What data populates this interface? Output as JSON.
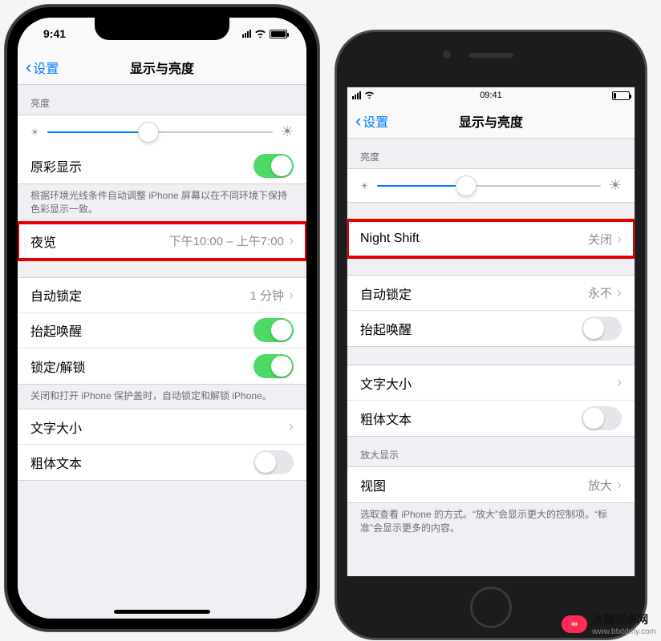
{
  "status": {
    "time": "9:41",
    "time8": "09:41"
  },
  "nav": {
    "back": "设置",
    "title": "显示与亮度"
  },
  "left": {
    "brightness_header": "亮度",
    "slider_percent": 45,
    "truetone": {
      "label": "原彩显示",
      "on": true
    },
    "truetone_note": "根据环境光线条件自动调整 iPhone 屏幕以在不同环境下保持色彩显示一致。",
    "nightshift": {
      "label": "夜览",
      "value": "下午10:00 – 上午7:00"
    },
    "autolock": {
      "label": "自动锁定",
      "value": "1 分钟"
    },
    "raise": {
      "label": "抬起唤醒",
      "on": true
    },
    "lockunlock": {
      "label": "锁定/解锁",
      "on": true
    },
    "lock_note": "关闭和打开 iPhone 保护盖时，自动锁定和解锁 iPhone。",
    "textsize": {
      "label": "文字大小"
    },
    "bold": {
      "label": "粗体文本",
      "on": false
    }
  },
  "right": {
    "brightness_header": "亮度",
    "slider_percent": 40,
    "nightshift": {
      "label": "Night Shift",
      "value": "关闭"
    },
    "autolock": {
      "label": "自动锁定",
      "value": "永不"
    },
    "raise": {
      "label": "抬起唤醒",
      "on": false
    },
    "textsize": {
      "label": "文字大小"
    },
    "bold": {
      "label": "粗体文本",
      "on": false
    },
    "zoom_header": "放大显示",
    "view": {
      "label": "视图",
      "value": "放大"
    },
    "zoom_note": "选取查看 iPhone 的方式。“放大”会显示更大的控制项。“标准”会显示更多的内容。"
  },
  "watermark": {
    "brand": "冰糖安卓网",
    "url": "www.btxtdmy.com"
  }
}
